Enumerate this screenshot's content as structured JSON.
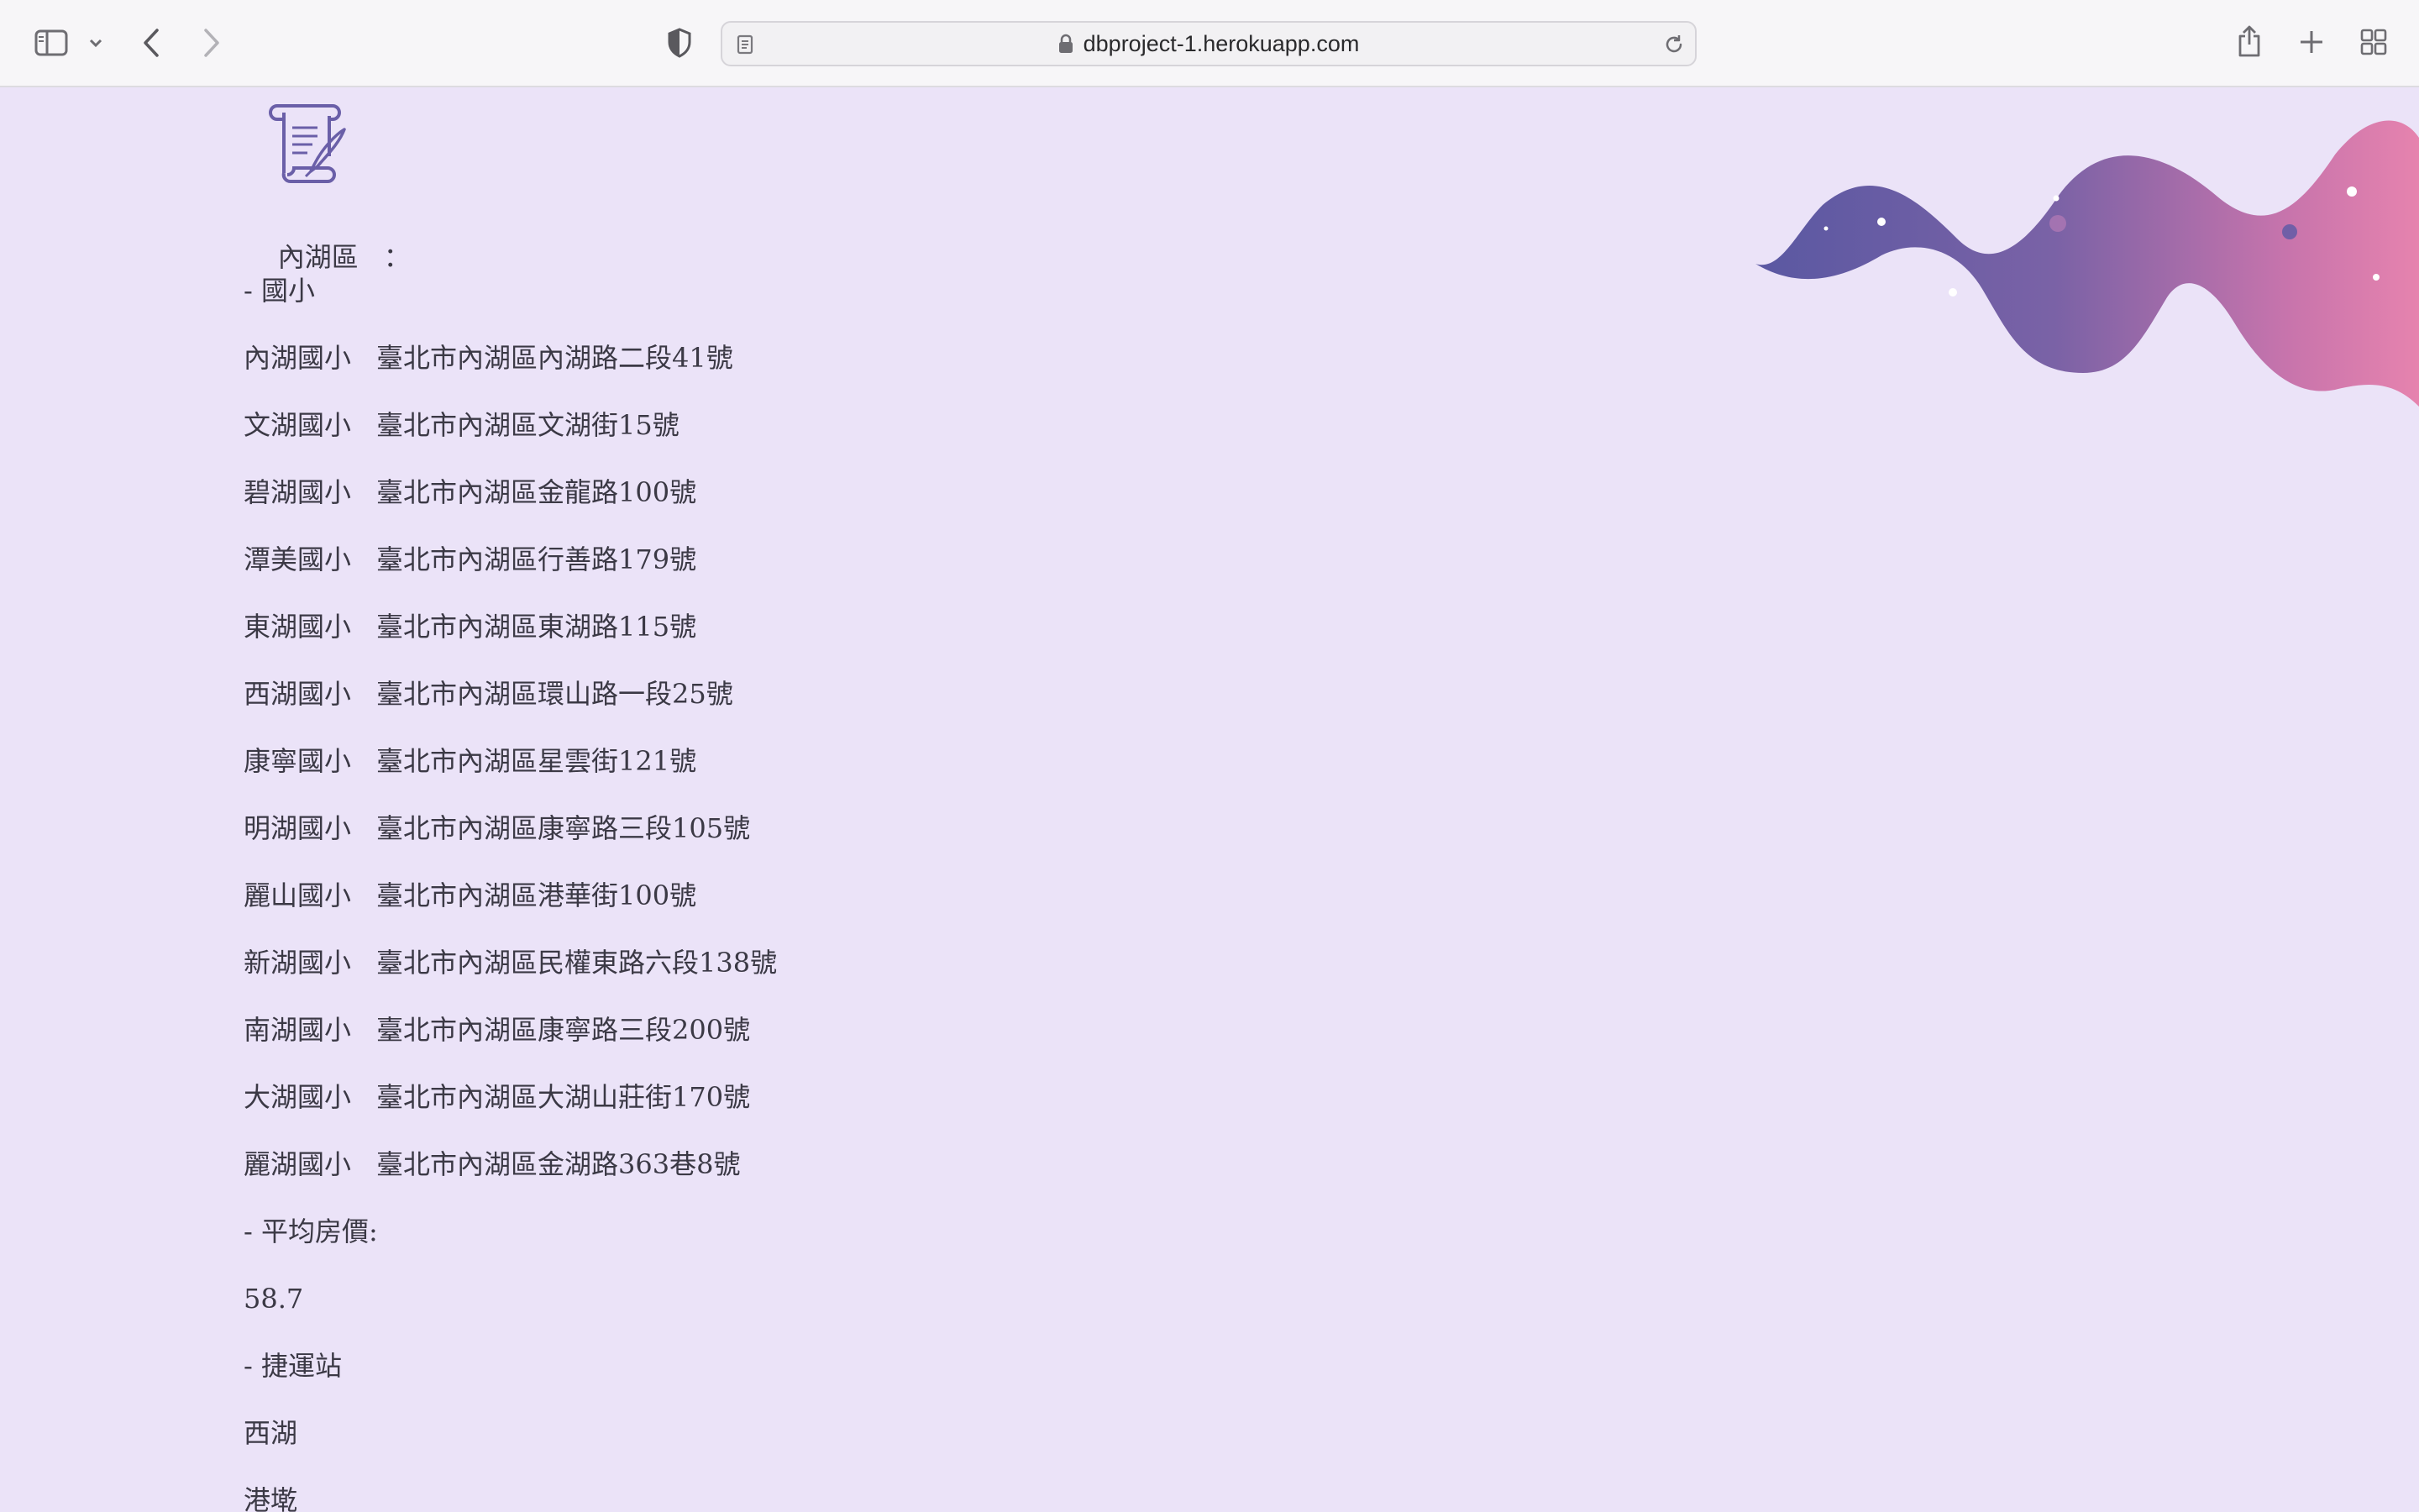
{
  "browser": {
    "url": "dbproject-1.herokuapp.com"
  },
  "page": {
    "district_label": "內湖區",
    "district_suffix": "：",
    "schools_heading": "- 國小",
    "schools": [
      {
        "name": "內湖國小",
        "address": "臺北市內湖區內湖路二段41號"
      },
      {
        "name": "文湖國小",
        "address": "臺北市內湖區文湖街15號"
      },
      {
        "name": "碧湖國小",
        "address": "臺北市內湖區金龍路100號"
      },
      {
        "name": "潭美國小",
        "address": "臺北市內湖區行善路179號"
      },
      {
        "name": "東湖國小",
        "address": "臺北市內湖區東湖路115號"
      },
      {
        "name": "西湖國小",
        "address": "臺北市內湖區環山路一段25號"
      },
      {
        "name": "康寧國小",
        "address": "臺北市內湖區星雲街121號"
      },
      {
        "name": "明湖國小",
        "address": "臺北市內湖區康寧路三段105號"
      },
      {
        "name": "麗山國小",
        "address": "臺北市內湖區港華街100號"
      },
      {
        "name": "新湖國小",
        "address": "臺北市內湖區民權東路六段138號"
      },
      {
        "name": "南湖國小",
        "address": "臺北市內湖區康寧路三段200號"
      },
      {
        "name": "大湖國小",
        "address": "臺北市內湖區大湖山莊街170號"
      },
      {
        "name": "麗湖國小",
        "address": "臺北市內湖區金湖路363巷8號"
      }
    ],
    "price_heading": "- 平均房價:",
    "price_value": "58.7",
    "mrt_heading": "- 捷運站",
    "mrt_stations": [
      "西湖",
      "港墘"
    ]
  },
  "colors": {
    "background": "#ebe3f8",
    "text": "#3b3945",
    "wave_start": "#5d5aa3",
    "wave_end": "#e57fae",
    "logo": "#6a5fa8"
  },
  "icons": [
    "sidebar-icon",
    "chevron-down-icon",
    "back-icon",
    "forward-icon",
    "privacy-shield-icon",
    "page-icon",
    "lock-icon",
    "reload-icon",
    "share-icon",
    "new-tab-icon",
    "tab-overview-icon",
    "scroll-quill-icon"
  ]
}
